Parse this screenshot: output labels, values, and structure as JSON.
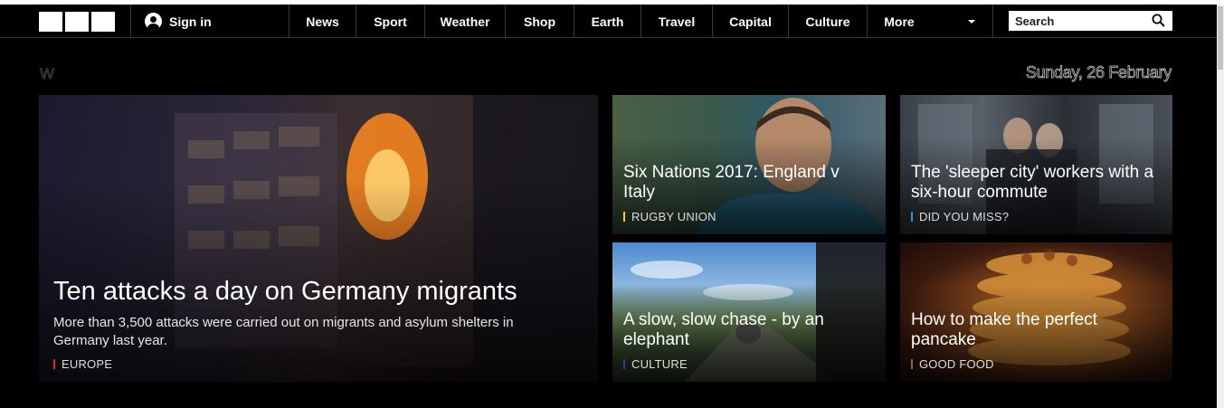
{
  "nav": {
    "signin_label": "Sign in",
    "items": [
      "News",
      "Sport",
      "Weather",
      "Shop",
      "Earth",
      "Travel",
      "Capital",
      "Culture",
      "More"
    ],
    "search_placeholder": "Search"
  },
  "header": {
    "edition": "W",
    "date": "Sunday, 26 February"
  },
  "hero": {
    "title": "Ten attacks a day on Germany migrants",
    "summary": "More than 3,500 attacks were carried out on migrants and asylum shelters in Germany last year.",
    "tag": "EUROPE",
    "tag_color": "#e8262a"
  },
  "cards": [
    {
      "title": "Six Nations 2017: England v Italy",
      "tag": "RUGBY UNION",
      "tag_color": "#f6d31b"
    },
    {
      "title": "The 'sleeper city' workers with a six-hour commute",
      "tag": "DID YOU MISS?",
      "tag_color": "#3a8fd6"
    },
    {
      "title": "A slow, slow chase - by an elephant",
      "tag": "CULTURE",
      "tag_color": "#2c3e9e"
    },
    {
      "title": "How to make the perfect pancake",
      "tag": "GOOD FOOD",
      "tag_color": "#8a6a2a"
    }
  ]
}
